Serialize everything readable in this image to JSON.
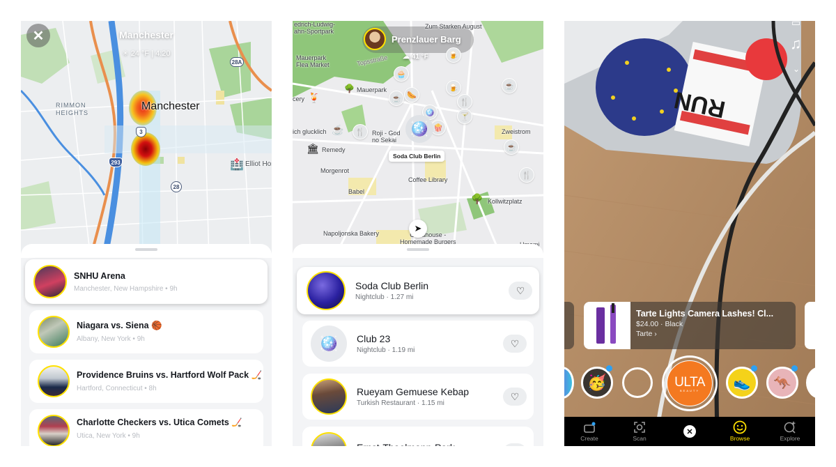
{
  "panels": {
    "map1": {
      "title": "Manchester",
      "weather_icon": "snowflake-icon",
      "weather_glyph": "✳",
      "temperature": "24 °F",
      "time": "4:20",
      "close_glyph": "✕",
      "map_labels": {
        "city": "Manchester",
        "neighborhood_line1": "RIMMON",
        "neighborhood_line2": "HEIGHTS",
        "hospital": "Elliot Hos",
        "route_3": "3",
        "route_28": "28",
        "route_28a": "28A",
        "route_293": "293"
      },
      "list": [
        {
          "title": "SNHU Arena",
          "emoji": "",
          "subtitle": "Manchester, New Hampshire • 9h"
        },
        {
          "title": "Niagara vs. Siena",
          "emoji": "🏀",
          "subtitle": "Albany, New York • 9h"
        },
        {
          "title": "Providence Bruins vs. Hartford Wolf Pack",
          "emoji": "🏒",
          "subtitle": "Hartford, Connecticut • 8h"
        },
        {
          "title": "Charlotte Checkers vs. Utica Comets",
          "emoji": "🏒",
          "subtitle": "Utica, New York • 9h"
        }
      ]
    },
    "map2": {
      "title": "Prenzlauer Barg",
      "weather_glyph": "☁",
      "temperature": "41 °F",
      "selected_place": "Soda Club Berlin",
      "map_labels": {
        "sportpark_line1": "edrich-Ludwig-",
        "sportpark_line2": "ahn-Sportpark",
        "zum_starken": "Zum Starken August",
        "flea_line1": "Mauerpark",
        "flea_line2": "Flea Market",
        "topsstrasse": "Topsstraße",
        "mauerpark": "Mauerpark",
        "cery": "cery",
        "glucklich": "ich glucklich",
        "roji_line1": "Roji - God",
        "roji_line2": "no Sekai",
        "zweistrom": "Zweistrom",
        "remedy": "Remedy",
        "morgenrot": "Morgenrot",
        "coffee_library": "Coffee Library",
        "babel": "Babel",
        "kollwitzplatz": "Kollwitzplatz",
        "napoljonska": "Napoljonska Bakery",
        "grindhouse_line1": "Grindhouse -",
        "grindhouse_line2": "Homemade Burgers",
        "umami": "Umami"
      },
      "list": [
        {
          "title": "Soda Club Berlin",
          "subtitle": "Nightclub · 1.27 mi"
        },
        {
          "title": "Club 23",
          "subtitle": "Nightclub · 1.19 mi"
        },
        {
          "title": "Rueyam Gemuese Kebap",
          "subtitle": "Turkish Restaurant · 1.15 mi"
        },
        {
          "title": "Ernst-Thaelmann-Park",
          "subtitle": ""
        }
      ]
    },
    "camera": {
      "product": {
        "title": "Tarte Lights  Camera  Lashes! Cl...",
        "price": "$24.00 · Black",
        "brand": "Tarte ›"
      },
      "lens_brand": "ULTA",
      "lens_brand_sub": "BEAUTY",
      "tabs": [
        {
          "label": "Create",
          "icon": "create-icon"
        },
        {
          "label": "Scan",
          "icon": "scan-icon"
        },
        {
          "label": "",
          "icon": "close-icon"
        },
        {
          "label": "Browse",
          "icon": "smiley-icon"
        },
        {
          "label": "Explore",
          "icon": "explore-icon"
        }
      ],
      "active_tab": "Browse",
      "colors": {
        "active": "#ffe100",
        "notification": "#2ea0f2",
        "ulta": "#f47920"
      }
    }
  }
}
